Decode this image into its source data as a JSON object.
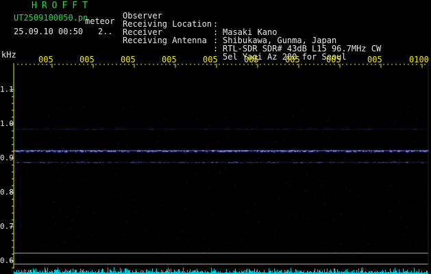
{
  "app": {
    "title": "HROFFT",
    "filename": "UT2509100050.pn",
    "mode": "meteor",
    "datetime": "25.09.10 00:50",
    "datetime_suffix": "2.."
  },
  "header": {
    "fields": [
      {
        "label": "Observer",
        "separator": ":",
        "value": "Masaki Kano"
      },
      {
        "label": "Receiving Location",
        "separator": ":",
        "value": "Shibukawa, Gunma, Japan"
      },
      {
        "label": "Receiver",
        "separator": ":",
        "value": "RTL-SDR SDR# 43dB L15 96.7MHz CW"
      },
      {
        "label": "Receiving Antenna",
        "separator": ":",
        "value": "5el Yagi Az 280 for Seoul"
      }
    ]
  },
  "axes": {
    "y_unit": "kHz",
    "y_ticks": [
      "1.1",
      "1.0",
      "0.9",
      "0.8",
      "0.7",
      "0.6"
    ],
    "x_ticks": [
      "005",
      "005",
      "005",
      "005",
      "005",
      "005",
      "005",
      "005",
      "005",
      "0100"
    ]
  },
  "chart_data": {
    "type": "heatmap",
    "ylabel": "kHz",
    "ylim": [
      0.57,
      1.19
    ],
    "y_ticks": [
      1.1,
      1.0,
      0.9,
      0.8,
      0.7,
      0.6
    ],
    "x_tick_labels": [
      "005",
      "005",
      "005",
      "005",
      "005",
      "005",
      "005",
      "005",
      "005",
      "0100"
    ],
    "signal_lines": [
      {
        "freq_khz": 0.922,
        "intensity": "strong"
      },
      {
        "freq_khz": 0.888,
        "intensity": "weak"
      },
      {
        "freq_khz": 0.985,
        "intensity": "faint"
      }
    ],
    "reference_lines_khz": [
      0.593,
      0.625
    ],
    "colors": {
      "background": "#000000",
      "signal": "#4f5cff",
      "noise_spectrum": "#00c8d8",
      "grid_ticks": "#f0f000",
      "reference_line": "#a0a0a0"
    }
  }
}
